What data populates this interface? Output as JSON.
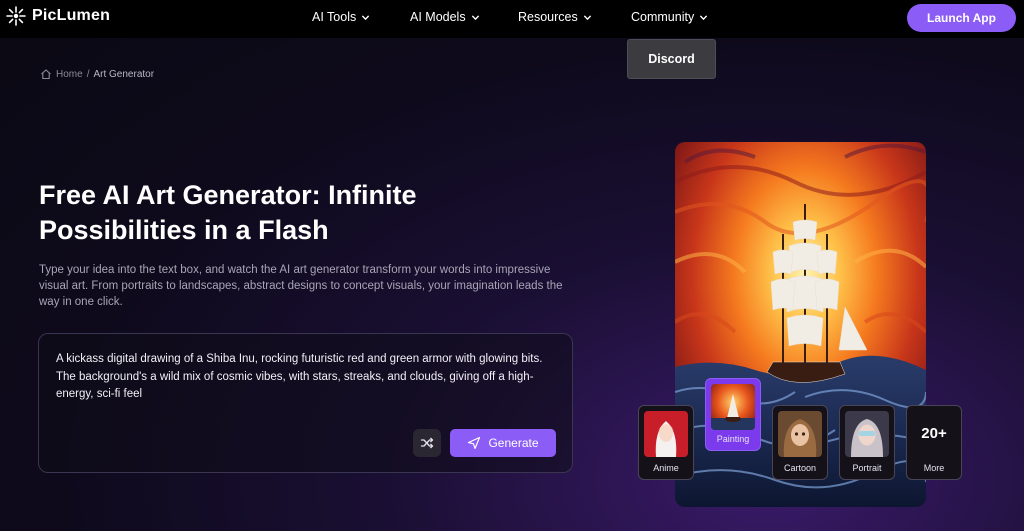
{
  "header": {
    "logo_text": "PicLumen",
    "nav": [
      {
        "label": "AI Tools"
      },
      {
        "label": "AI Models"
      },
      {
        "label": "Resources"
      },
      {
        "label": "Community"
      }
    ],
    "launch_label": "Launch App",
    "dropdown_item": "Discord"
  },
  "breadcrumb": {
    "home": "Home",
    "separator": "/",
    "current": "Art Generator"
  },
  "hero": {
    "title": "Free AI Art Generator: Infinite Possibilities in a Flash",
    "description": "Type your idea into the text box, and watch the AI art generator transform your words into impressive visual art. From portraits to landscapes, abstract designs to concept visuals, your imagination leads the way in one click."
  },
  "prompt": {
    "text": "A kickass digital drawing of a Shiba Inu, rocking futuristic red and green armor with glowing bits. The background's a wild mix of cosmic vibes, with stars, streaks, and clouds, giving off a high-energy, sci-fi feel",
    "generate_label": "Generate"
  },
  "styles": [
    {
      "label": "Anime"
    },
    {
      "label": "Painting",
      "active": true
    },
    {
      "label": "Cartoon"
    },
    {
      "label": "Portrait"
    },
    {
      "label": "More",
      "badge": "20+"
    }
  ],
  "colors": {
    "accent": "#8b5cf6",
    "topbar": "#000000",
    "background": "#0e0a1c"
  },
  "icons": [
    "sparkle-logo-icon",
    "chevron-down-icon",
    "home-icon",
    "shuffle-icon",
    "send-icon"
  ]
}
